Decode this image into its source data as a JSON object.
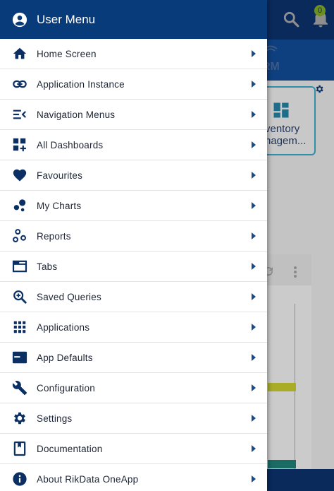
{
  "header": {
    "title": "User Menu",
    "icon": "account-circle-icon"
  },
  "menu": [
    {
      "label": "Home Screen",
      "icon": "home-icon"
    },
    {
      "label": "Application Instance",
      "icon": "link-icon"
    },
    {
      "label": "Navigation Menus",
      "icon": "menu-open-icon"
    },
    {
      "label": "All Dashboards",
      "icon": "dashboard-add-icon"
    },
    {
      "label": "Favourites",
      "icon": "heart-icon"
    },
    {
      "label": "My Charts",
      "icon": "bubble-chart-icon"
    },
    {
      "label": "Reports",
      "icon": "workflow-icon"
    },
    {
      "label": "Tabs",
      "icon": "tab-icon"
    },
    {
      "label": "Saved Queries",
      "icon": "zoom-in-icon"
    },
    {
      "label": "Applications",
      "icon": "apps-grid-icon"
    },
    {
      "label": "App Defaults",
      "icon": "web-asset-icon"
    },
    {
      "label": "Configuration",
      "icon": "wrench-icon"
    },
    {
      "label": "Settings",
      "icon": "gear-icon"
    },
    {
      "label": "Documentation",
      "icon": "book-icon"
    },
    {
      "label": "About RikData OneApp",
      "icon": "info-icon"
    }
  ],
  "background": {
    "notification_count": "0",
    "section_label": "RM",
    "card_label_line1": "ventory",
    "card_label_line2": "nagem..."
  },
  "colors": {
    "drawer_header": "#073b7a",
    "icon": "#0b2f63",
    "chevron": "#1b4a8a",
    "app_topbar": "#0a2a5c"
  }
}
